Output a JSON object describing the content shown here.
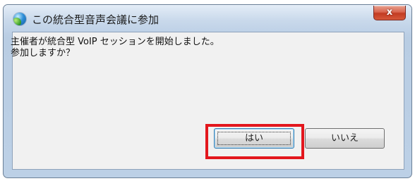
{
  "window": {
    "title": "この統合型音声会議に参加",
    "close_label": "x",
    "icon": "globe-icon"
  },
  "message": {
    "line1": "主催者が統合型 VoIP セッションを開始しました。",
    "line2": "参加しますか？"
  },
  "buttons": {
    "yes_label": "はい",
    "no_label": "いいえ"
  },
  "annotation": {
    "highlight_color": "#e3171d",
    "target": "yes-button"
  }
}
